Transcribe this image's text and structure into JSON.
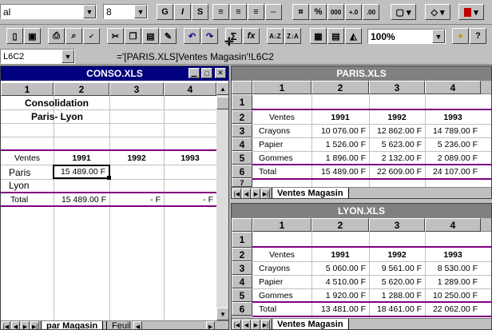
{
  "toolbar1": {
    "font_name": "al",
    "font_size": "8",
    "bold": "G",
    "italic": "I",
    "underline": "S",
    "percent": "%",
    "thousands": "000"
  },
  "toolbar2": {
    "sum": "Σ",
    "fx": "fx",
    "zoom": "100%"
  },
  "formula_bar": {
    "cell_ref": "L6C2",
    "formula": "='[PARIS.XLS]Ventes Magasin'!L6C2"
  },
  "conso": {
    "title": "CONSO.XLS",
    "cols": [
      "1",
      "2",
      "3",
      "4"
    ],
    "heading1": "Consolidation",
    "heading2": "Paris- Lyon",
    "ventes": "Ventes",
    "years": [
      "1991",
      "1992",
      "1993"
    ],
    "rows": [
      {
        "label": "Paris",
        "v1": "15 489.00 F",
        "v2": "",
        "v3": ""
      },
      {
        "label": "Lyon",
        "v1": "",
        "v2": "",
        "v3": ""
      },
      {
        "label": "Total",
        "v1": "15 489.00 F",
        "v2": "-   F",
        "v3": "-   F"
      }
    ],
    "tab1": "par Magasin",
    "tab2": "Feuil"
  },
  "paris": {
    "title": "PARIS.XLS",
    "cols": [
      "1",
      "2",
      "3",
      "4"
    ],
    "rownums": [
      "1",
      "2",
      "3",
      "4",
      "5",
      "6",
      "7"
    ],
    "ventes": "Ventes",
    "years": [
      "1991",
      "1992",
      "1993"
    ],
    "rows": [
      {
        "label": "Crayons",
        "v": [
          "10 076.00 F",
          "12 862.00 F",
          "14 789.00 F"
        ]
      },
      {
        "label": "Papier",
        "v": [
          "1 526.00 F",
          "5 623.00 F",
          "5 236.00 F"
        ]
      },
      {
        "label": "Gommes",
        "v": [
          "1 896.00 F",
          "2 132.00 F",
          "2 089.00 F"
        ]
      },
      {
        "label": "Total",
        "v": [
          "15 489.00 F",
          "22 609.00 F",
          "24 107.00 F"
        ]
      }
    ],
    "tab": "Ventes Magasin"
  },
  "lyon": {
    "title": "LYON.XLS",
    "cols": [
      "1",
      "2",
      "3",
      "4"
    ],
    "rownums": [
      "1",
      "2",
      "3",
      "4",
      "5",
      "6"
    ],
    "ventes": "Ventes",
    "years": [
      "1991",
      "1992",
      "1993"
    ],
    "rows": [
      {
        "label": "Crayons",
        "v": [
          "5 060.00 F",
          "9 561.00 F",
          "8 530.00 F"
        ]
      },
      {
        "label": "Papier",
        "v": [
          "4 510.00 F",
          "5 620.00 F",
          "1 289.00 F"
        ]
      },
      {
        "label": "Gommes",
        "v": [
          "1 920.00 F",
          "1 288.00 F",
          "10 250.00 F"
        ]
      },
      {
        "label": "Total",
        "v": [
          "13 481.00 F",
          "18 461.00 F",
          "22 062.00 F"
        ]
      }
    ],
    "tab": "Ventes Magasin"
  }
}
